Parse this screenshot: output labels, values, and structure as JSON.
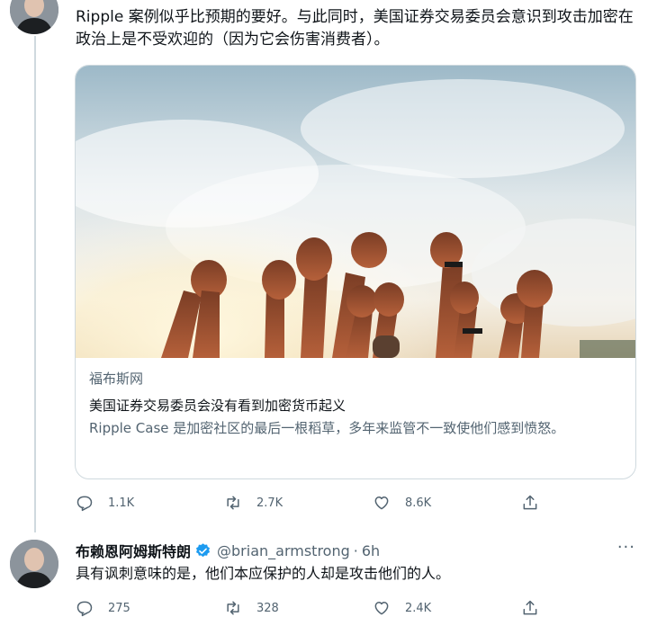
{
  "tweet1": {
    "text": "Ripple 案例似乎比预期的要好。与此同时，美国证券交易委员会意识到攻击加密在政治上是不受欢迎的（因为它会伤害消费者）。",
    "card": {
      "source": "福布斯网",
      "title": "美国证券交易委员会没有看到加密货币起义",
      "description": "Ripple Case 是加密社区的最后一根稻草，多年来监管不一致使他们感到愤怒。",
      "image_icon": "raised-fists-photo"
    },
    "actions": {
      "replies": "1.1K",
      "retweets": "2.7K",
      "likes": "8.6K"
    }
  },
  "tweet2": {
    "display_name": "布赖恩阿姆斯特朗",
    "handle": "@brian_armstrong",
    "separator": "·",
    "time": "6h",
    "more": "···",
    "text": "具有讽刺意味的是，他们本应保护的人却是攻击他们的人。",
    "actions": {
      "replies": "275",
      "retweets": "328",
      "likes": "2.4K"
    }
  },
  "colors": {
    "text_primary": "#0f1419",
    "text_secondary": "#536471",
    "verified": "#1d9bf0",
    "border": "#cfd9de"
  },
  "icons": [
    "reply-icon",
    "retweet-icon",
    "like-icon",
    "share-icon",
    "verified-badge-icon",
    "more-icon"
  ]
}
